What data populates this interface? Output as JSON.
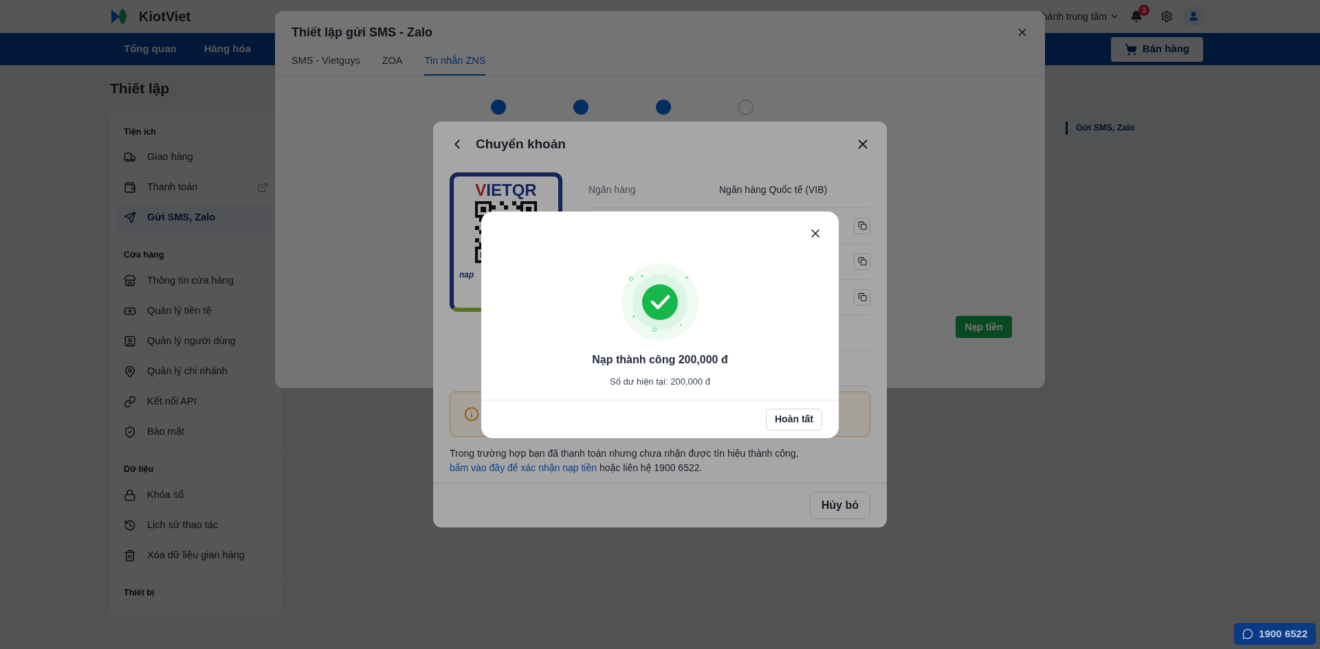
{
  "header": {
    "logo": "KiotViet",
    "branch": "hánh trung tâm",
    "notification_count": "3"
  },
  "nav": {
    "items": [
      "Tổng quan",
      "Hàng hóa"
    ],
    "sell_button": "Bán hàng"
  },
  "page_title": "Thiết lập",
  "sidebar": {
    "sections": [
      {
        "title": "Tiện ích",
        "items": [
          {
            "label": "Giao hàng",
            "selected": false,
            "external": false
          },
          {
            "label": "Thanh toán",
            "selected": false,
            "external": true
          },
          {
            "label": "Gửi SMS, Zalo",
            "selected": true,
            "external": false
          }
        ]
      },
      {
        "title": "Cửa hàng",
        "items": [
          {
            "label": "Thông tin cửa hàng",
            "selected": false,
            "external": false
          },
          {
            "label": "Quản lý tiền tệ",
            "selected": false,
            "external": false
          },
          {
            "label": "Quản lý người dùng",
            "selected": false,
            "external": false
          },
          {
            "label": "Quản lý chi nhánh",
            "selected": false,
            "external": false
          },
          {
            "label": "Kết nối API",
            "selected": false,
            "external": false
          },
          {
            "label": "Bảo mật",
            "selected": false,
            "external": false
          }
        ]
      },
      {
        "title": "Dữ liệu",
        "items": [
          {
            "label": "Khóa sổ",
            "selected": false,
            "external": false
          },
          {
            "label": "Lịch sử thao tác",
            "selected": false,
            "external": false
          },
          {
            "label": "Xóa dữ liệu gian hàng",
            "selected": false,
            "external": false
          }
        ]
      },
      {
        "title": "Thiết bị"
      }
    ]
  },
  "outline": [
    {
      "label": "Gửi SMS, Zalo",
      "selected": true
    }
  ],
  "settings_dialog": {
    "title": "Thiết lập gửi SMS - Zalo",
    "tabs": [
      {
        "label": "SMS - Vietguys",
        "selected": false
      },
      {
        "label": "ZOA",
        "selected": false
      },
      {
        "label": "Tin nhắn ZNS",
        "selected": true
      }
    ],
    "steps": [
      {
        "done": true
      },
      {
        "done": true
      },
      {
        "done": true
      },
      {
        "done": false
      }
    ],
    "topup_button": "Nạp tiền"
  },
  "transfer_dialog": {
    "title": "Chuyển khoản",
    "qr_brand": "VIETQR",
    "qr_footer": "nap",
    "info_rows": [
      {
        "kind": "text",
        "label": "Ngân hàng",
        "value": "Ngân hàng Quốc tế (VIB)"
      },
      {
        "kind": "copy"
      },
      {
        "kind": "copy"
      },
      {
        "kind": "copy"
      },
      {
        "kind": "blank"
      },
      {
        "kind": "blank"
      }
    ],
    "note": "Trong trường hợp bạn đã thanh toán nhưng chưa nhận được tín hiệu thành công,",
    "note_link": "bấm vào đây để xác nhận nạp tiền",
    "note_end": "hoặc liên hệ 1900 6522.",
    "cancel_button": "Hủy bỏ"
  },
  "success_dialog": {
    "title": "Nạp thành công 200,000 đ",
    "balance": "Số dư hiện tại: 200,000 đ",
    "done_button": "Hoàn tất"
  },
  "hotline": "1900 6522"
}
